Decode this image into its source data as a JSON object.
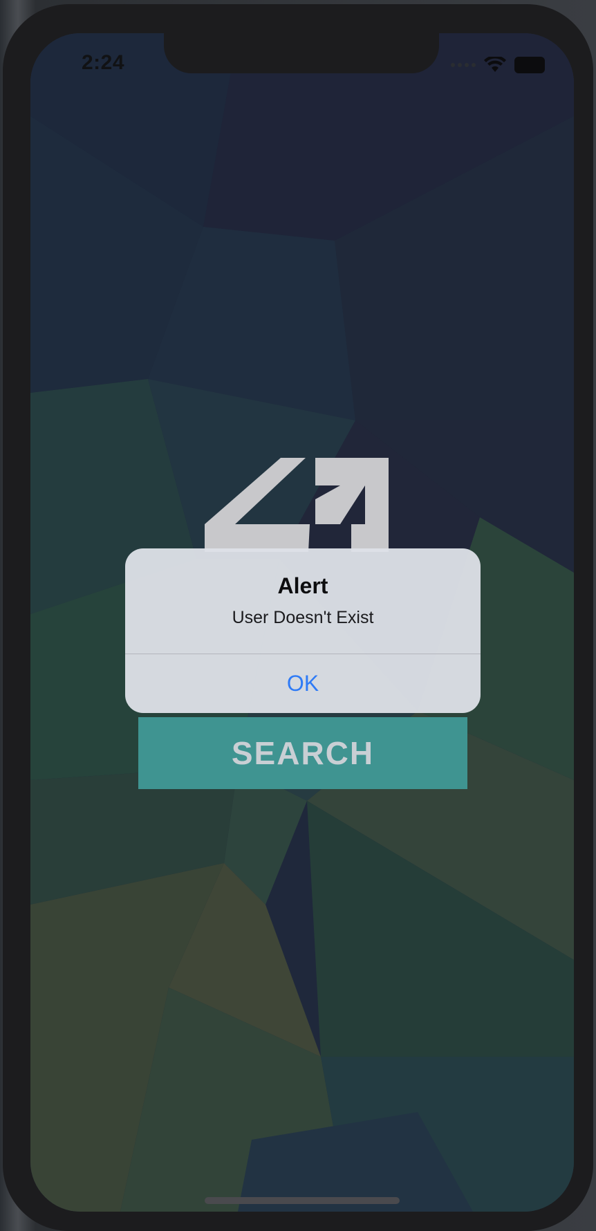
{
  "status_bar": {
    "time": "2:24",
    "wifi_icon": "wifi-icon",
    "battery_icon": "battery-icon",
    "signal_icon": "cellular-signal-icon"
  },
  "logo": {
    "icon": "app-logo"
  },
  "main": {
    "search_label": "SEARCH"
  },
  "alert": {
    "title": "Alert",
    "message": "User Doesn't Exist",
    "ok_label": "OK"
  },
  "colors": {
    "search_button": "#3f9491",
    "alert_action": "#2f7bf6",
    "alert_background": "#dee1e8"
  }
}
